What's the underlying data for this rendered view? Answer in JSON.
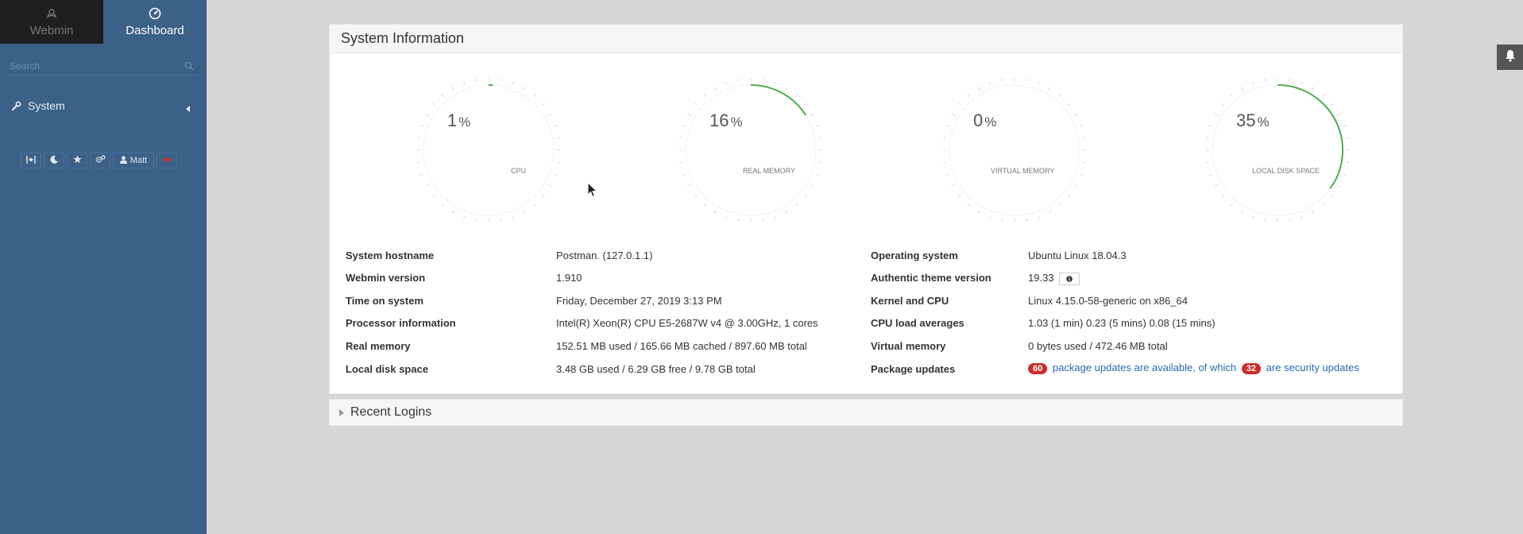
{
  "sidebar": {
    "tabs": [
      {
        "label": "Webmin",
        "icon": "webmin-logo-icon"
      },
      {
        "label": "Dashboard",
        "icon": "dashboard-gauge-icon"
      }
    ],
    "search_placeholder": "Search",
    "menu": [
      {
        "label": "System",
        "icon": "wrench-icon"
      }
    ],
    "toolbar": [
      {
        "icon": "collapse-icon"
      },
      {
        "icon": "moon-icon"
      },
      {
        "icon": "star-icon"
      },
      {
        "icon": "cogs-icon"
      },
      {
        "icon": "user-icon",
        "label": "Matt"
      },
      {
        "icon": "logout-icon"
      }
    ]
  },
  "panel": {
    "title": "System Information",
    "gauges": [
      {
        "value": "1",
        "unit": "%",
        "label": "CPU",
        "percent": 1
      },
      {
        "value": "16",
        "unit": "%",
        "label": "REAL MEMORY",
        "percent": 16
      },
      {
        "value": "0",
        "unit": "%",
        "label": "VIRTUAL MEMORY",
        "percent": 0
      },
      {
        "value": "35",
        "unit": "%",
        "label": "LOCAL DISK SPACE",
        "percent": 35
      }
    ],
    "info_left": [
      {
        "key": "System hostname",
        "value": "Postman. (127.0.1.1)"
      },
      {
        "key": "Webmin version",
        "value": "1.910"
      },
      {
        "key": "Time on system",
        "value": "Friday, December 27, 2019 3:13 PM"
      },
      {
        "key": "Processor information",
        "value": "Intel(R) Xeon(R) CPU E5-2687W v4 @ 3.00GHz, 1 cores"
      },
      {
        "key": "Real memory",
        "value": "152.51 MB used / 165.66 MB cached / 897.60 MB total"
      },
      {
        "key": "Local disk space",
        "value": "3.48 GB used / 6.29 GB free / 9.78 GB total"
      }
    ],
    "info_right": [
      {
        "key": "Operating system",
        "value": "Ubuntu Linux 18.04.3"
      },
      {
        "key": "Authentic theme version",
        "value": "19.33"
      },
      {
        "key": "Kernel and CPU",
        "value": "Linux 4.15.0-58-generic on x86_64"
      },
      {
        "key": "CPU load averages",
        "value": "1.03 (1 min) 0.23 (5 mins) 0.08 (15 mins)"
      },
      {
        "key": "Virtual memory",
        "value": "0 bytes used / 472.46 MB total"
      },
      {
        "key": "Package updates",
        "value": ""
      }
    ],
    "package_updates": {
      "count": "60",
      "text1": "package updates are available, of which",
      "security_count": "32",
      "text2": "are security updates"
    }
  },
  "recent_logins": {
    "title": "Recent Logins"
  },
  "colors": {
    "sidebar": "#3b6189",
    "gauge_arc": "#4cae4c",
    "badge": "#c9302c",
    "link": "#2a6ab1"
  }
}
